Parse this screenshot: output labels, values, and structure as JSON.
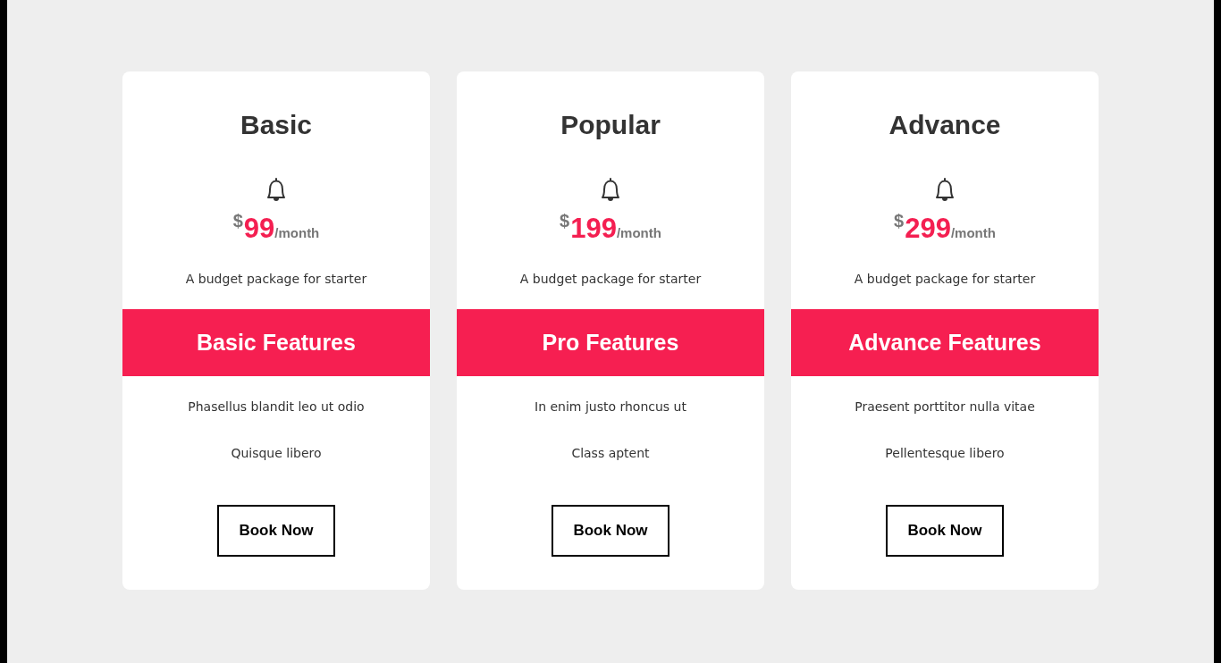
{
  "plans": [
    {
      "title": "Basic",
      "currency": "$",
      "price": "99",
      "period": "/month",
      "description": "A budget package for starter",
      "features_heading": "Basic Features",
      "features": [
        "Phasellus blandit leo ut odio",
        "Quisque libero"
      ],
      "button": "Book Now"
    },
    {
      "title": "Popular",
      "currency": "$",
      "price": "199",
      "period": "/month",
      "description": "A budget package for starter",
      "features_heading": "Pro Features",
      "features": [
        "In enim justo rhoncus ut",
        "Class aptent"
      ],
      "button": "Book Now"
    },
    {
      "title": "Advance",
      "currency": "$",
      "price": "299",
      "period": "/month",
      "description": "A budget package for starter",
      "features_heading": "Advance Features",
      "features": [
        "Praesent porttitor nulla vitae",
        "Pellentesque libero"
      ],
      "button": "Book Now"
    }
  ]
}
